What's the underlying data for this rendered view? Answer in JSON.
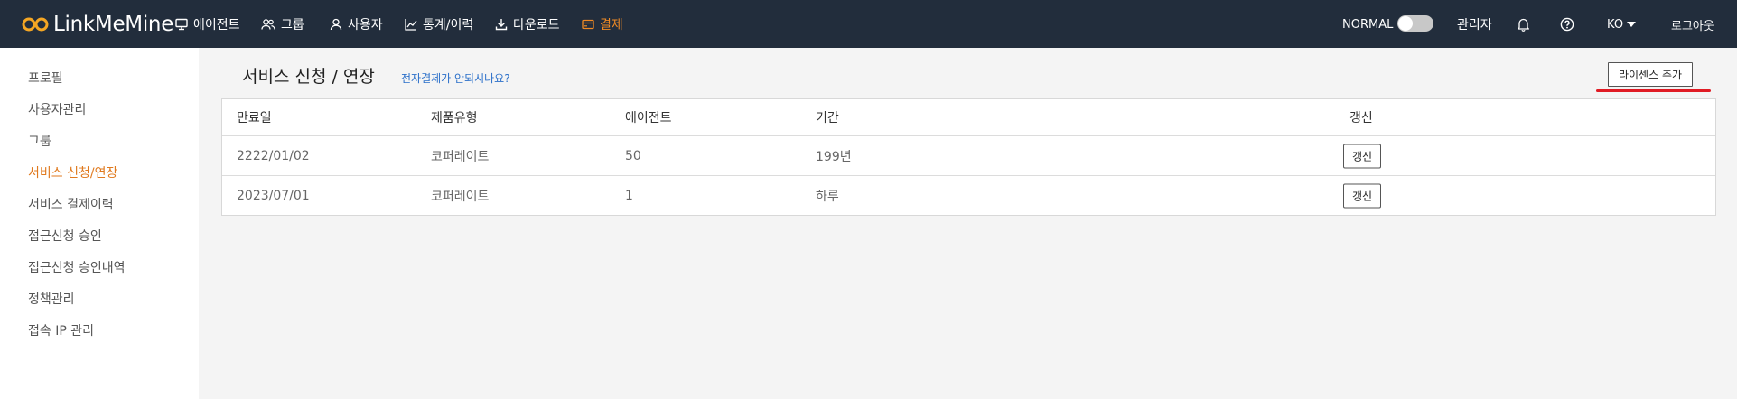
{
  "app": {
    "name": "LinkMeMine"
  },
  "nav": {
    "items": [
      {
        "label": "에이전트",
        "icon": "monitor-icon"
      },
      {
        "label": "그룹",
        "icon": "users-icon"
      },
      {
        "label": "사용자",
        "icon": "user-icon"
      },
      {
        "label": "통계/이력",
        "icon": "chart-icon"
      },
      {
        "label": "다운로드",
        "icon": "download-icon"
      },
      {
        "label": "결제",
        "icon": "card-icon",
        "active": true
      }
    ]
  },
  "topbar_right": {
    "mode_label": "NORMAL",
    "mode_toggle_on": false,
    "admin_label": "관리자",
    "language": "KO",
    "logout_label": "로그아웃"
  },
  "sidebar": {
    "items": [
      {
        "label": "프로필"
      },
      {
        "label": "사용자관리"
      },
      {
        "label": "그룹"
      },
      {
        "label": "서비스 신청/연장",
        "active": true
      },
      {
        "label": "서비스 결제이력"
      },
      {
        "label": "접근신청 승인"
      },
      {
        "label": "접근신청 승인내역"
      },
      {
        "label": "정책관리"
      },
      {
        "label": "접속 IP 관리"
      }
    ]
  },
  "main": {
    "title": "서비스 신청 / 연장",
    "help_link": "전자결제가 안되시나요?",
    "add_license_label": "라이센스 추가",
    "table": {
      "columns": [
        "만료일",
        "제품유형",
        "에이전트",
        "기간",
        "갱신"
      ],
      "rows": [
        {
          "expiry": "2222/01/02",
          "product": "코퍼레이트",
          "agents": "50",
          "period": "199년",
          "renew_label": "갱신"
        },
        {
          "expiry": "2023/07/01",
          "product": "코퍼레이트",
          "agents": "1",
          "period": "하루",
          "renew_label": "갱신"
        }
      ]
    }
  },
  "colors": {
    "topbar_bg": "#222d3c",
    "accent": "#f08a24",
    "link": "#2a6fc9",
    "highlight_underline": "#e01b24"
  }
}
